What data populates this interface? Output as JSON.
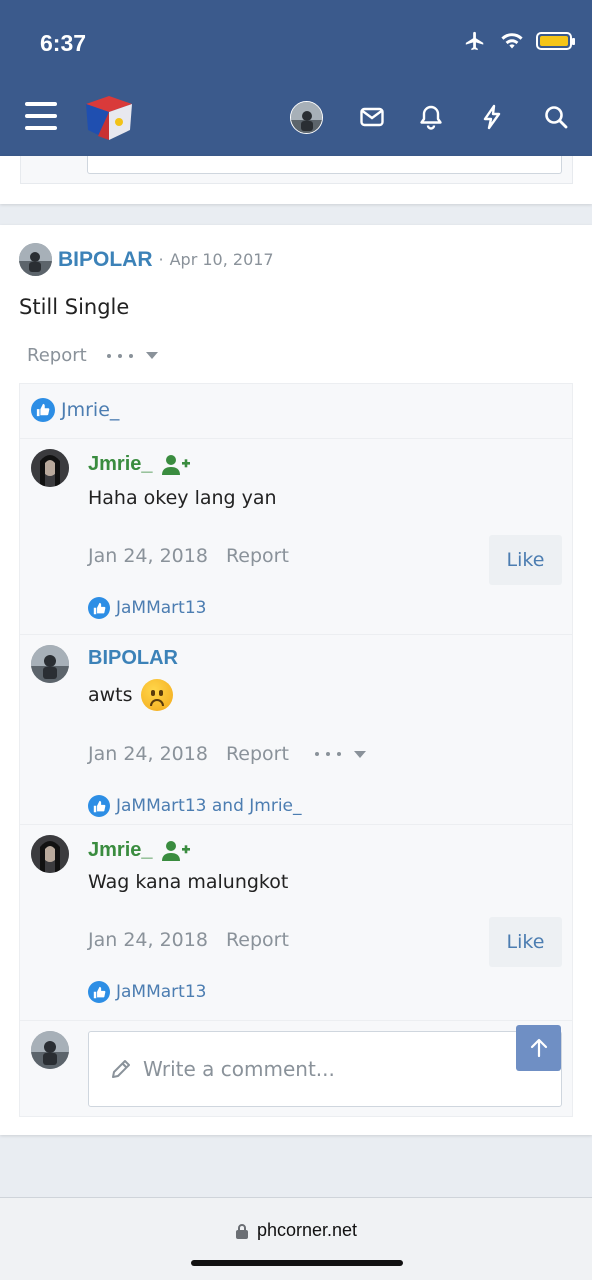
{
  "status": {
    "time": "6:37"
  },
  "post": {
    "author": "BIPOLAR",
    "separator": "·",
    "date": "Apr 10, 2017",
    "body": "Still Single",
    "report": "Report",
    "reaction_users": "Jmrie_"
  },
  "comments": [
    {
      "author": "Jmrie_",
      "text": "Haha okey lang yan",
      "date": "Jan 24, 2018",
      "report": "Report",
      "like": "Like",
      "reactions": "JaMMart13"
    },
    {
      "author": "BIPOLAR",
      "text": "awts",
      "date": "Jan 24, 2018",
      "report": "Report",
      "reactions": "JaMMart13 and Jmrie_"
    },
    {
      "author": "Jmrie_",
      "text": "Wag kana malungkot",
      "date": "Jan 24, 2018",
      "report": "Report",
      "like": "Like",
      "reactions": "JaMMart13"
    }
  ],
  "composer": {
    "placeholder": "Write a comment..."
  },
  "browser": {
    "url": "phcorner.net"
  },
  "colors": {
    "header": "#3b5a8c",
    "author_blue": "#3c82b8",
    "author_green": "#3a8c3f",
    "link": "#4c7db1",
    "like_badge": "#2d8ee5"
  },
  "icons": [
    "airplane-icon",
    "wifi-icon",
    "battery-icon",
    "menu-icon",
    "site-logo",
    "mail-icon",
    "bell-icon",
    "bolt-icon",
    "search-icon",
    "like-icon",
    "add-user-icon",
    "pencil-icon",
    "arrow-up-icon",
    "lock-icon"
  ]
}
